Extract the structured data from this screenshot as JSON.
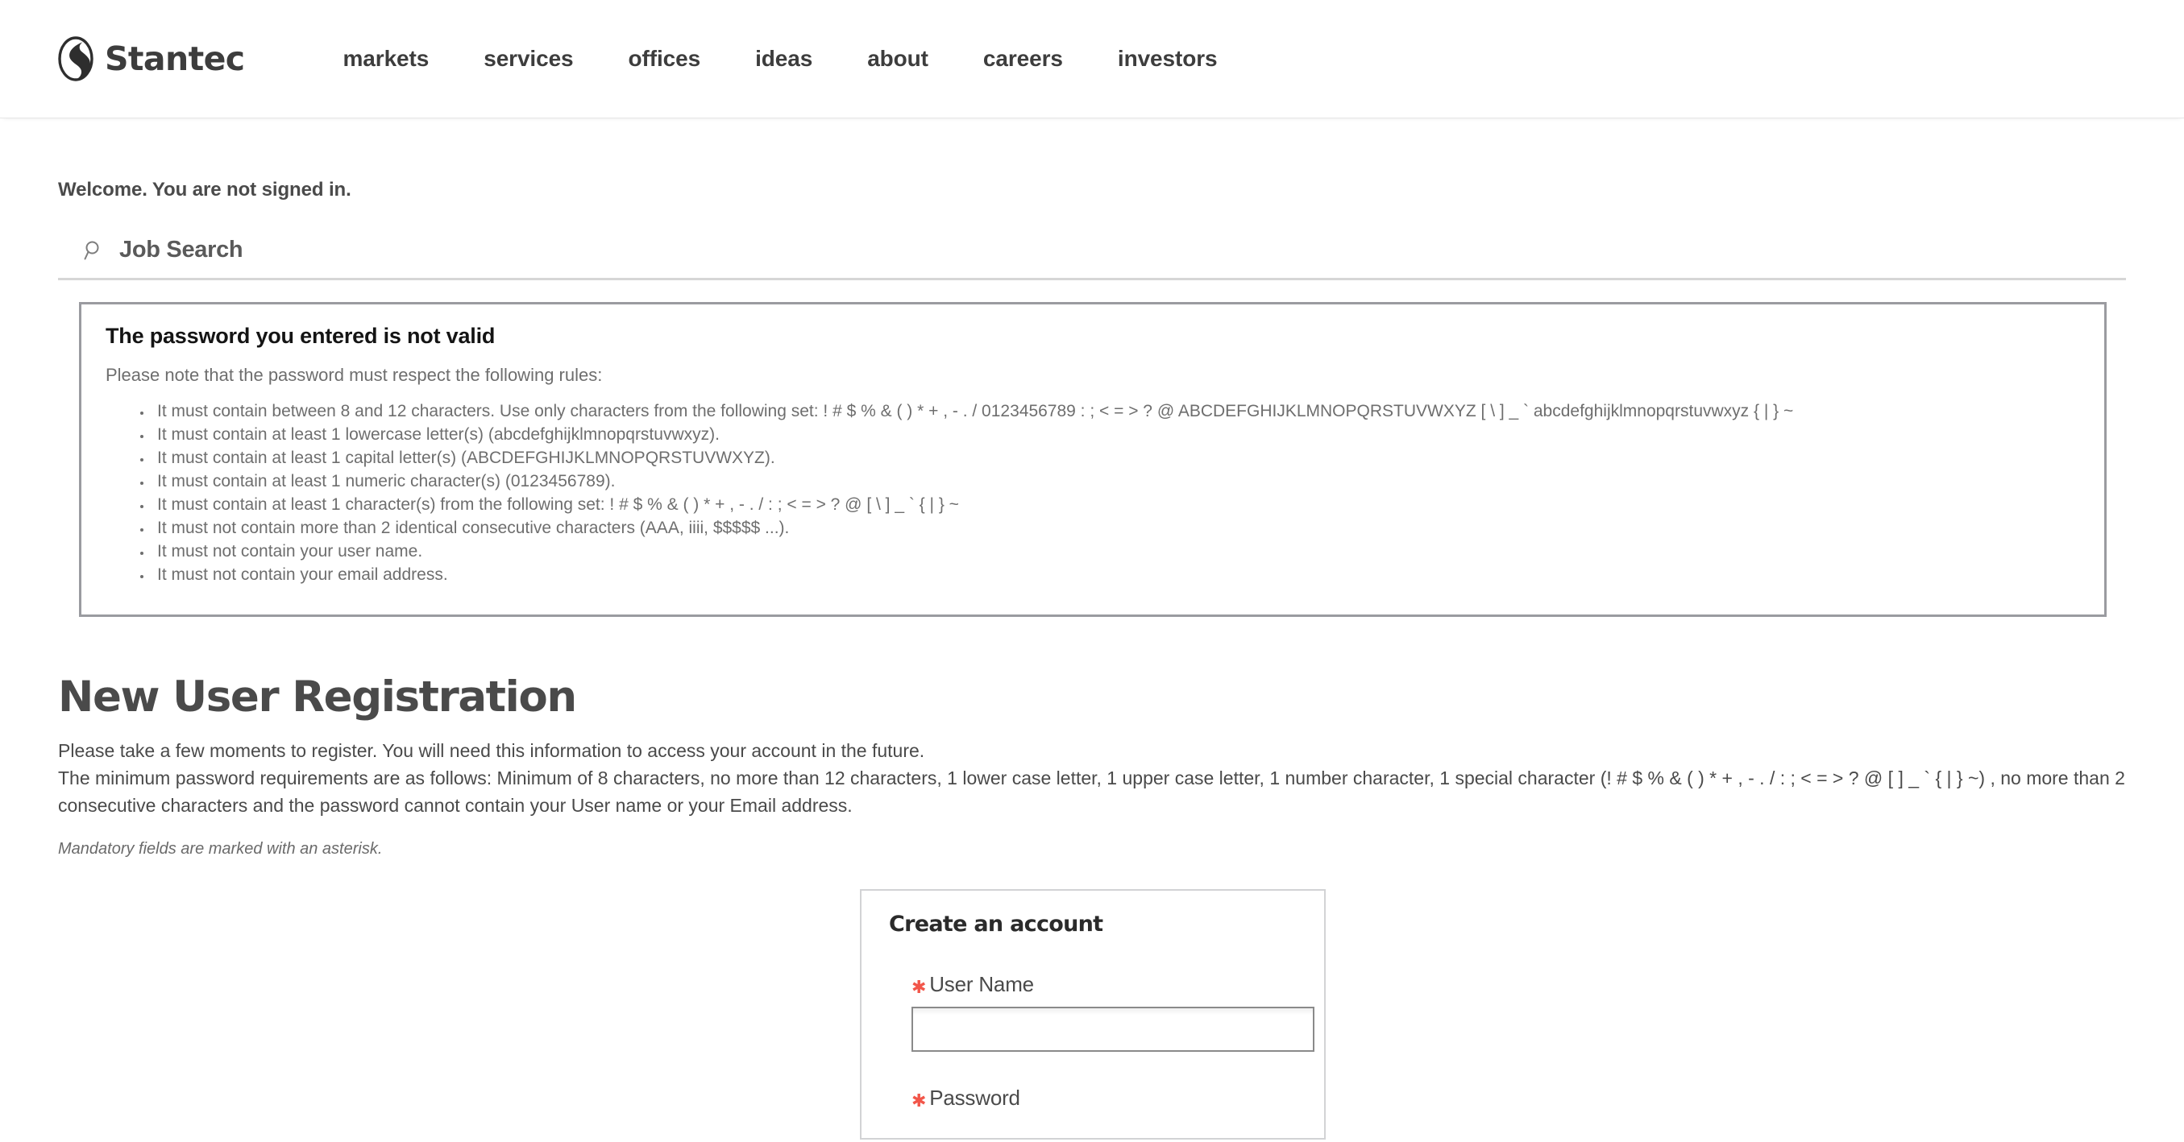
{
  "header": {
    "brand": {
      "name": "Stantec",
      "logo_icon": "stantec-circle-logo"
    },
    "nav": [
      {
        "label": "markets"
      },
      {
        "label": "services"
      },
      {
        "label": "offices"
      },
      {
        "label": "ideas"
      },
      {
        "label": "about"
      },
      {
        "label": "careers"
      },
      {
        "label": "investors"
      }
    ]
  },
  "page": {
    "welcome": "Welcome. You are not signed in.",
    "job_search": {
      "icon": "magnifier-icon",
      "label": "Job Search"
    },
    "error": {
      "title": "The password you entered is not valid",
      "subtitle": "Please note that the password must respect the following rules:",
      "rules": [
        "It must contain between 8 and 12 characters. Use only characters from the following set: ! # $ % & ( ) * + , - . / 0123456789 : ; < = > ? @ ABCDEFGHIJKLMNOPQRSTUVWXYZ [ \\ ] _ ` abcdefghijklmnopqrstuvwxyz { | } ~",
        "It must contain at least 1 lowercase letter(s) (abcdefghijklmnopqrstuvwxyz).",
        "It must contain at least 1 capital letter(s) (ABCDEFGHIJKLMNOPQRSTUVWXYZ).",
        "It must contain at least 1 numeric character(s) (0123456789).",
        "It must contain at least 1 character(s) from the following set: ! # $ % & ( ) * + , - . / : ; < = > ? @ [ \\ ] _ ` { | } ~",
        "It must not contain more than 2 identical consecutive characters (AAA, iiii, $$$$$ ...).",
        "It must not contain your user name.",
        "It must not contain your email address."
      ]
    },
    "registration": {
      "title": "New User Registration",
      "intro_line1": "Please take a few moments to register. You will need this information to access your account in the future.",
      "intro_line2": "The minimum password requirements are as follows: Minimum of 8 characters, no more than 12 characters, 1 lower case letter, 1 upper case letter, 1 number character, 1 special character (! # $ % & ( ) * + , - . / : ; < = > ? @ [ ] _ ` { | } ~) , no more than 2 consecutive characters and the password cannot contain your User name or your Email address.",
      "mandatory_note": "Mandatory fields are marked with an asterisk."
    },
    "account_card": {
      "title": "Create an account",
      "asterisk": "✱",
      "fields": [
        {
          "label": "User Name",
          "value": "",
          "placeholder": ""
        },
        {
          "label": "Password",
          "value": "",
          "placeholder": ""
        }
      ]
    }
  },
  "colors": {
    "required_asterisk": "#f2564a",
    "text_primary": "#4a4a4a",
    "text_muted": "#6e6e6e",
    "border_strong": "#9a9ba0",
    "border_light": "#d2d3d5"
  }
}
